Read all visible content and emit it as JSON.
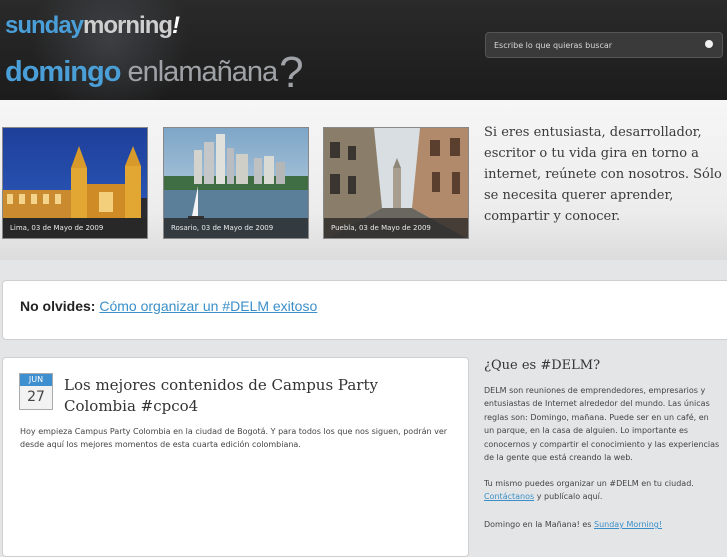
{
  "header": {
    "logo_sunday": "sunday",
    "logo_morning": "morning",
    "logo_bang": "!",
    "logo_domingo": "domingo",
    "logo_enlamanana": "enlamañana",
    "logo_q": "?",
    "search_placeholder": "Escribe lo que quieras buscar"
  },
  "photos": [
    {
      "caption": "Lima, 03 de Mayo de 2009"
    },
    {
      "caption": "Rosario, 03 de Mayo de 2009"
    },
    {
      "caption": "Puebla, 03 de Mayo de 2009"
    }
  ],
  "intro": "Si eres entusiasta, desarrollador, escritor o tu vida gira en torno a internet, reúnete con nosotros. Sólo se necesita querer aprender, compartir y conocer.",
  "reminder": {
    "label": "No olvides:",
    "link": "Cómo organizar un #DELM exitoso"
  },
  "post": {
    "month": "JUN",
    "day": "27",
    "title": "Los mejores contenidos de Campus Party Colombia #cpco4",
    "body": "Hoy empieza Campus Party Colombia en la ciudad de Bogotá. Y para todos los que nos siguen, podrán ver desde aquí los mejores momentos de esta cuarta edición colombiana."
  },
  "sidebar": {
    "title": "¿Que es #DELM?",
    "p1": "DELM son reuniones de emprendedores, empresarios y entusiastas de Internet alrededor del mundo. Las únicas reglas son: Domingo, mañana. Puede ser en un café, en un parque, en la casa de alguien. Lo importante es conocernos y compartir el conocimiento y las experiencias de la gente que está creando la web.",
    "p2_text": "Tu mismo puedes organizar un #DELM en tu ciudad.",
    "p2_link": "Contáctanos",
    "p2_tail": " y publícalo aquí.",
    "p3_text": "Domingo en la Mañana! es ",
    "p3_link": "Sunday Morning!"
  },
  "colors": {
    "accent": "#4a9fd8",
    "link": "#3a8fc9",
    "header_bg": "#1c1c1c"
  }
}
